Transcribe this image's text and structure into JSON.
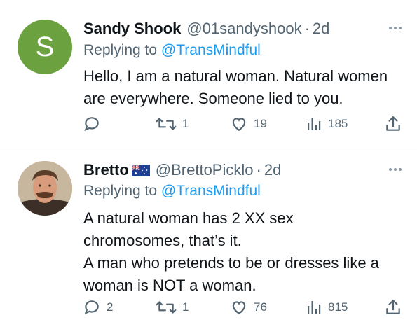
{
  "tweets": [
    {
      "avatar_letter": "S",
      "name": "Sandy Shook",
      "handle": "@01sandyshook",
      "separator": "·",
      "time": "2d",
      "replying_label": "Replying to",
      "replying_to": "@TransMindful",
      "text": "Hello, I am a natural woman. Natural women\nare everywhere.  Someone lied to you.",
      "replies": "",
      "retweets": "1",
      "likes": "19",
      "views": "185",
      "avatar_color": "#6ba13e"
    },
    {
      "name": "Bretto",
      "name_flag": "australia-flag",
      "handle": "@BrettoPicklo",
      "separator": "·",
      "time": "2d",
      "replying_label": "Replying to",
      "replying_to": "@TransMindful",
      "text": "A natural woman has 2 XX sex\nchromosomes, that’s it.\nA man who pretends to be or dresses like a\nwoman is NOT a woman.",
      "replies": "2",
      "retweets": "1",
      "likes": "76",
      "views": "815"
    }
  ],
  "colors": {
    "link": "#1d9bf0",
    "secondary_text": "#536471",
    "divider": "#eff3f4"
  }
}
